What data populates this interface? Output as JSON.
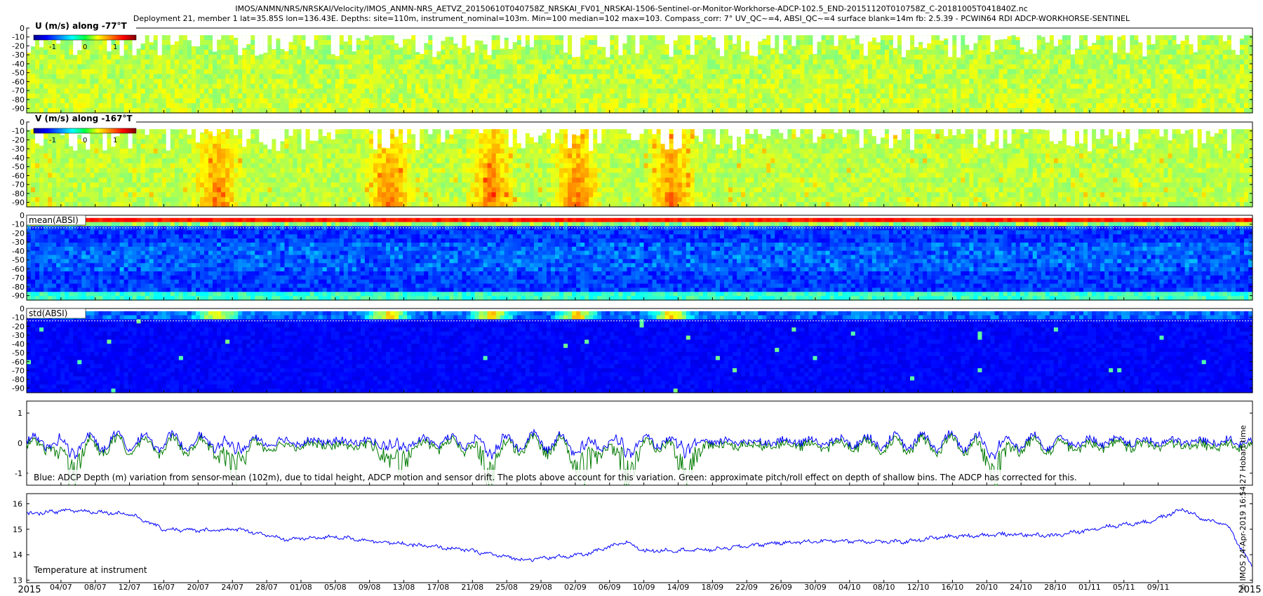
{
  "header": {
    "title_line1": "IMOS/ANMN/NRS/NRSKAI/Velocity/IMOS_ANMN-NRS_AETVZ_20150610T040758Z_NRSKAI_FV01_NRSKAI-1506-Sentinel-or-Monitor-Workhorse-ADCP-102.5_END-20151120T010758Z_C-20181005T041840Z.nc",
    "title_line2": "Deployment 21, member 1 lat=35.85S lon=136.43E. Depths: site=110m, instrument_nominal=103m. Min=100 median=102 max=103. Compass_corr: 7° UV_QC~=4, ABSI_QC~=4 surface blank=14m fb: 2.5.39 - PCWIN64 RDI ADCP-WORKHORSE-SENTINEL"
  },
  "credit": "© IMOS 24-Apr-2019 16:54:27 Hobart time",
  "colorbar": {
    "ticks": [
      "-1",
      "0",
      "1"
    ]
  },
  "colors": {
    "line_blue": "#0000ff",
    "line_green": "#007a00",
    "frame": "#000000"
  },
  "chart_data": [
    {
      "type": "heatmap",
      "title": "U (m/s) along -77°T",
      "ylim": [
        -95,
        0
      ],
      "yticks": [
        0,
        -10,
        -20,
        -30,
        -40,
        -50,
        -60,
        -70,
        -80,
        -90
      ],
      "colorbar_range": [
        -1.5,
        1.5
      ],
      "colormap": "jet",
      "description_values": {
        "typical": 0.1,
        "range": [
          -0.6,
          0.9
        ]
      }
    },
    {
      "type": "heatmap",
      "title": "V (m/s) along -167°T",
      "ylim": [
        -95,
        0
      ],
      "yticks": [
        0,
        -10,
        -20,
        -30,
        -40,
        -50,
        -60,
        -70,
        -80,
        -90
      ],
      "colorbar_range": [
        -1.5,
        1.5
      ],
      "colormap": "jet",
      "events": [
        "22/07",
        "11/08",
        "23/08",
        "02/09",
        "13/09"
      ]
    },
    {
      "type": "heatmap",
      "title": "mean(ABSI)",
      "ylim": [
        -95,
        0
      ],
      "yticks": [
        0,
        -10,
        -20,
        -30,
        -40,
        -50,
        -60,
        -70,
        -80,
        -90
      ],
      "colormap": "jet"
    },
    {
      "type": "heatmap",
      "title": "std(ABSI)",
      "ylim": [
        -95,
        0
      ],
      "yticks": [
        0,
        -10,
        -20,
        -30,
        -40,
        -50,
        -60,
        -70,
        -80,
        -90
      ],
      "colormap": "jet"
    },
    {
      "type": "line",
      "annotation": "Blue: ADCP Depth (m) variation from sensor-mean (102m), due to tidal height, ADCP motion and sensor drift. The plots above account for this variation. Green: approximate pitch/roll effect on depth of shallow bins. The ADCP has corrected for this.",
      "ylim": [
        -1.4,
        1.4
      ],
      "yticks": [
        1,
        0,
        -1
      ],
      "series": [
        {
          "color": "#0000ff",
          "typical_range": [
            -0.45,
            0.45
          ]
        },
        {
          "color": "#007a00",
          "dip_dates": [
            "05/07",
            "24/07",
            "12/08",
            "23/08",
            "03/09",
            "08/09",
            "15/09",
            "21/10"
          ],
          "dip_depth": -1.2
        }
      ]
    },
    {
      "type": "line",
      "annotation": "Temperature at instrument",
      "ylim": [
        12.9,
        16.4
      ],
      "yticks": [
        16,
        15,
        14,
        13
      ],
      "series": [
        {
          "color": "#0000ff",
          "points": [
            [
              "2015-06-10",
              15.5
            ],
            [
              "2015-06-20",
              15.4
            ],
            [
              "2015-06-30",
              15.6
            ],
            [
              "2015-07-05",
              15.75
            ],
            [
              "2015-07-12",
              15.6
            ],
            [
              "2015-07-16",
              15.0
            ],
            [
              "2015-07-20",
              14.95
            ],
            [
              "2015-07-25",
              15.0
            ],
            [
              "2015-07-30",
              14.6
            ],
            [
              "2015-08-05",
              14.7
            ],
            [
              "2015-08-12",
              14.45
            ],
            [
              "2015-08-20",
              14.2
            ],
            [
              "2015-08-27",
              13.8
            ],
            [
              "2015-09-03",
              14.0
            ],
            [
              "2015-09-08",
              14.5
            ],
            [
              "2015-09-10",
              14.15
            ],
            [
              "2015-09-18",
              14.2
            ],
            [
              "2015-09-25",
              14.45
            ],
            [
              "2015-10-02",
              14.55
            ],
            [
              "2015-10-10",
              14.5
            ],
            [
              "2015-10-15",
              14.7
            ],
            [
              "2015-10-22",
              14.8
            ],
            [
              "2015-10-28",
              14.75
            ],
            [
              "2015-11-03",
              15.1
            ],
            [
              "2015-11-08",
              15.3
            ],
            [
              "2015-11-12",
              15.8
            ],
            [
              "2015-11-14",
              15.4
            ],
            [
              "2015-11-17",
              15.2
            ],
            [
              "2015-11-20",
              13.5
            ]
          ]
        }
      ]
    }
  ],
  "x_axis": {
    "start": "2015-06-30",
    "end": "2015-11-20",
    "ticks": [
      [
        "2015-06-30",
        "2015"
      ],
      [
        "2015-07-04",
        "04/07"
      ],
      [
        "2015-07-08",
        "08/07"
      ],
      [
        "2015-07-12",
        "12/07"
      ],
      [
        "2015-07-16",
        "16/07"
      ],
      [
        "2015-07-20",
        "20/07"
      ],
      [
        "2015-07-24",
        "24/07"
      ],
      [
        "2015-07-28",
        "28/07"
      ],
      [
        "2015-08-01",
        "01/08"
      ],
      [
        "2015-08-05",
        "05/08"
      ],
      [
        "2015-08-09",
        "09/08"
      ],
      [
        "2015-08-13",
        "13/08"
      ],
      [
        "2015-08-17",
        "17/08"
      ],
      [
        "2015-08-21",
        "21/08"
      ],
      [
        "2015-08-25",
        "25/08"
      ],
      [
        "2015-08-29",
        "29/08"
      ],
      [
        "2015-09-02",
        "02/09"
      ],
      [
        "2015-09-06",
        "06/09"
      ],
      [
        "2015-09-10",
        "10/09"
      ],
      [
        "2015-09-14",
        "14/09"
      ],
      [
        "2015-09-18",
        "18/09"
      ],
      [
        "2015-09-22",
        "22/09"
      ],
      [
        "2015-09-26",
        "26/09"
      ],
      [
        "2015-09-30",
        "30/09"
      ],
      [
        "2015-10-04",
        "04/10"
      ],
      [
        "2015-10-08",
        "08/10"
      ],
      [
        "2015-10-12",
        "12/10"
      ],
      [
        "2015-10-16",
        "16/10"
      ],
      [
        "2015-10-20",
        "20/10"
      ],
      [
        "2015-10-24",
        "24/10"
      ],
      [
        "2015-10-28",
        "28/10"
      ],
      [
        "2015-11-01",
        "01/11"
      ],
      [
        "2015-11-05",
        "05/11"
      ],
      [
        "2015-11-09",
        "09/11"
      ],
      [
        "2015-11-20",
        "2015"
      ]
    ]
  }
}
